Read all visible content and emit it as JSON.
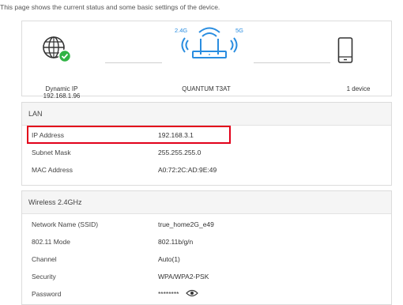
{
  "intro": "This page shows the current status and some basic settings of the device.",
  "status": {
    "internet_type": "Dynamic IP",
    "internet_ip": "192.168.1.96",
    "router_name": "QUANTUM T3AT",
    "band_24": "2.4G",
    "band_5": "5G",
    "clients": "1 device",
    "internet_ok_color": "#2fb344",
    "router_color": "#2a8de0"
  },
  "lan": {
    "title": "LAN",
    "rows": [
      {
        "label": "IP Address",
        "value": "192.168.3.1"
      },
      {
        "label": "Subnet Mask",
        "value": "255.255.255.0"
      },
      {
        "label": "MAC Address",
        "value": "A0:72:2C:AD:9E:49"
      }
    ]
  },
  "wireless": {
    "title": "Wireless 2.4GHz",
    "rows": [
      {
        "label": "Network Name (SSID)",
        "value": "true_home2G_e49"
      },
      {
        "label": "802.11 Mode",
        "value": "802.11b/g/n"
      },
      {
        "label": "Channel",
        "value": "Auto(1)"
      },
      {
        "label": "Security",
        "value": "WPA/WPA2-PSK"
      },
      {
        "label": "Password",
        "value": "********"
      }
    ]
  },
  "highlight_color": "#e2001a"
}
